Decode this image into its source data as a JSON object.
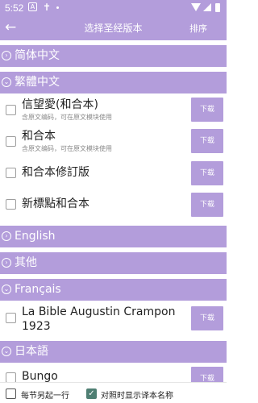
{
  "status_bar": {
    "time": "5:52",
    "icons": [
      "a-box-icon",
      "cross-icon",
      "dot-icon",
      "wifi-icon",
      "signal-icon",
      "battery-icon"
    ]
  },
  "toolbar": {
    "back_icon": "back-arrow-icon",
    "title": "选择圣经版本",
    "sort_label": "排序"
  },
  "sections": [
    {
      "label": "简体中文",
      "expanded": false
    },
    {
      "label": "繁體中文",
      "expanded": true
    },
    {
      "label": "English",
      "expanded": false
    },
    {
      "label": "其他",
      "expanded": false
    },
    {
      "label": "Français",
      "expanded": true
    },
    {
      "label": "日本語",
      "expanded": true
    }
  ],
  "rows": [
    {
      "name": "信望愛(和合本)",
      "desc": "含原文编码，可在原文模块使用",
      "button": "下载"
    },
    {
      "name": "和合本",
      "desc": "含原文编码，可在原文模块使用",
      "button": "下载"
    },
    {
      "name": "和合本修訂版",
      "button": "下载"
    },
    {
      "name": "新標點和合本",
      "button": "下载"
    },
    {
      "name": "La Bible Augustin Crampon",
      "name_line2": "1923",
      "button": "下载"
    },
    {
      "name": "Bungo",
      "button": "下载"
    }
  ],
  "bottom_bar": {
    "new_line_label": "每节另起一行",
    "new_line_checked": false,
    "show_name_label": "对照时显示译本名称",
    "show_name_checked": true
  },
  "colors": {
    "accent": "#b39ddb",
    "checkbox_checked": "#4f7f73"
  }
}
